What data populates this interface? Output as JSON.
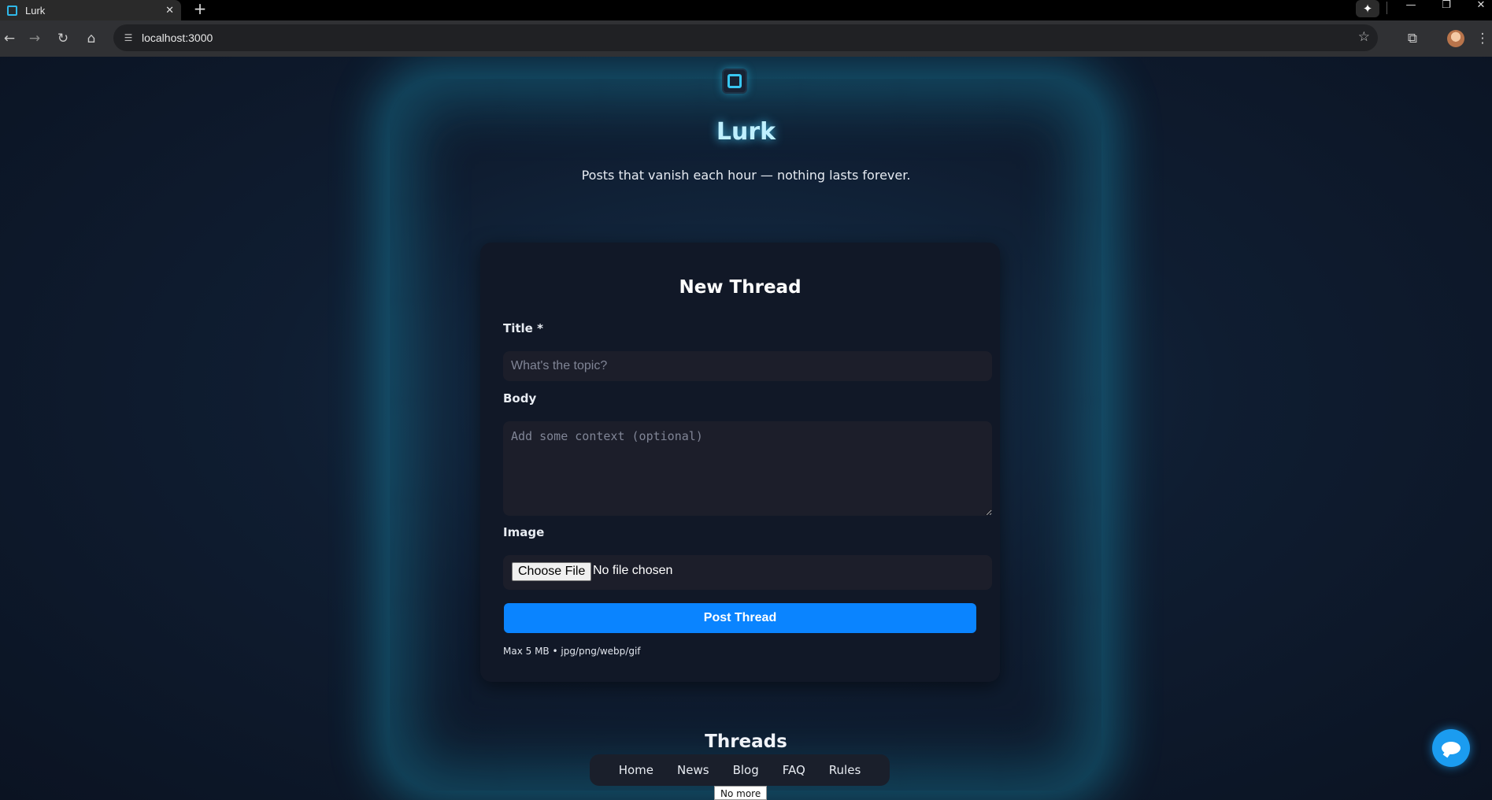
{
  "browser": {
    "tab_title": "Lurk",
    "tab_close": "✕",
    "new_tab": "+",
    "url": "localhost:3000",
    "icons": [
      "back-icon",
      "forward-icon",
      "reload-icon",
      "home-icon",
      "site-info-icon",
      "star-icon",
      "tab-search-icon",
      "profile-avatar",
      "menu-icon",
      "gemini-icon"
    ]
  },
  "header": {
    "title": "Lurk",
    "tagline": "Posts that vanish each hour — nothing lasts forever."
  },
  "form": {
    "heading": "New Thread",
    "title_label": "Title *",
    "title_placeholder": "What's the topic?",
    "body_label": "Body",
    "body_placeholder": "Add some context (optional)",
    "image_label": "Image",
    "choose_file_label": "Choose File",
    "file_status": "No file chosen",
    "submit_label": "Post Thread",
    "hint": "Max 5 MB • jpg/png/webp/gif"
  },
  "threads": {
    "heading": "Threads",
    "status_tooltip": "No more"
  },
  "nav": {
    "items": [
      "Home",
      "News",
      "Blog",
      "FAQ",
      "Rules"
    ]
  },
  "colors": {
    "accent": "#0a84ff",
    "glow": "#2ec5f0",
    "card": "#111827",
    "page_bg": "#0d1524"
  }
}
